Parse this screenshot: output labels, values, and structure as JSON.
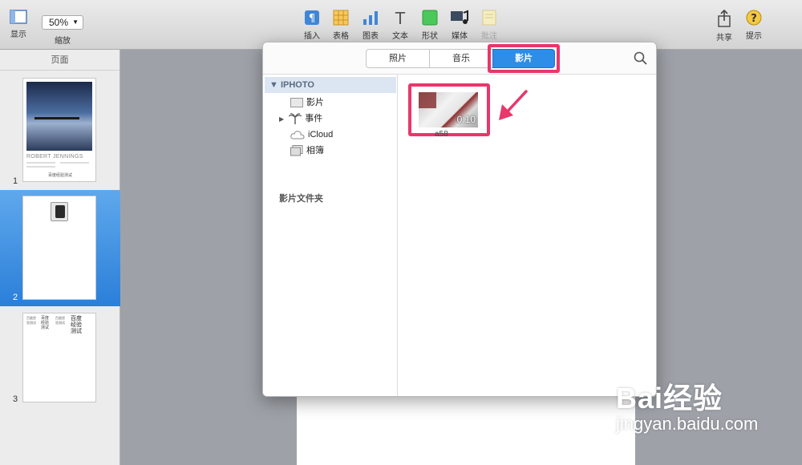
{
  "toolbar": {
    "view_label": "显示",
    "zoom_value": "50%",
    "zoom_label": "缩放",
    "insert_label": "插入",
    "table_label": "表格",
    "chart_label": "图表",
    "text_label": "文本",
    "shape_label": "形状",
    "media_label": "媒体",
    "comment_label": "批注",
    "share_label": "共享",
    "tips_label": "提示"
  },
  "sidebar": {
    "title": "页面",
    "pages": [
      {
        "num": "1",
        "heading": "ROBERT JENNINGS",
        "caption": "百度经验测试"
      },
      {
        "num": "2"
      },
      {
        "num": "3",
        "col1": "百度经验测试",
        "col2": "百度经验测试",
        "col3": "百度经验测试",
        "col4": "百度经验测试"
      }
    ]
  },
  "media_browser": {
    "tabs": [
      {
        "label": "照片"
      },
      {
        "label": "音乐"
      },
      {
        "label": "影片"
      }
    ],
    "source_header": "IPHOTO",
    "sources": [
      {
        "label": "影片"
      },
      {
        "label": "事件"
      },
      {
        "label": "iCloud"
      },
      {
        "label": "相簿"
      }
    ],
    "folder_label": "影片文件夹",
    "video": {
      "duration": "0:10",
      "name": "a58"
    }
  },
  "colors": {
    "accent": "#2e8de6",
    "highlight": "#e8376b",
    "selected_page": "#3a8ee6"
  },
  "watermark": {
    "brand": "Bai经验",
    "url": "jingyan.baidu.com"
  }
}
